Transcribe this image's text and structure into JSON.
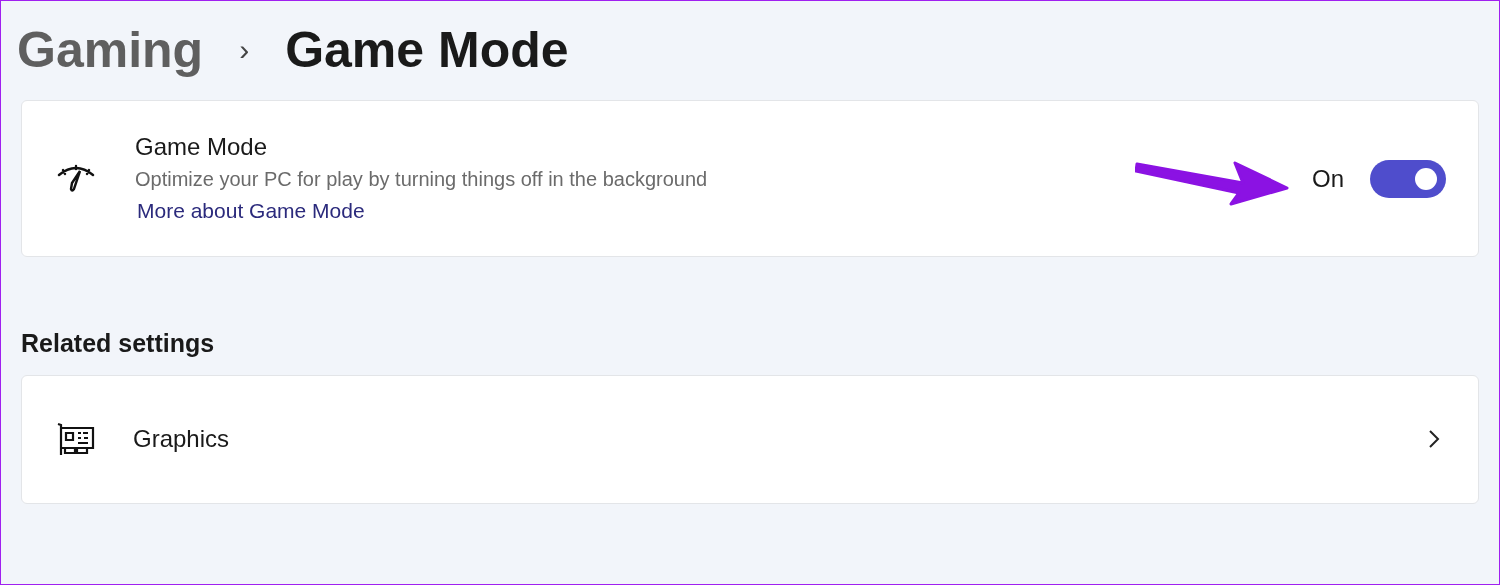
{
  "breadcrumb": {
    "parent": "Gaming",
    "separator": "›",
    "current": "Game Mode"
  },
  "game_mode_card": {
    "title": "Game Mode",
    "description": "Optimize your PC for play by turning things off in the background",
    "link": "More about Game Mode",
    "toggle": {
      "label": "On",
      "on": true
    }
  },
  "related_settings": {
    "heading": "Related settings",
    "items": [
      {
        "label": "Graphics"
      }
    ]
  }
}
